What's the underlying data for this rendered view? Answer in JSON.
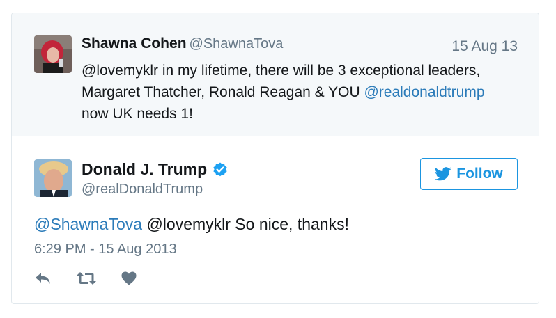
{
  "quoted_tweet": {
    "author_name": "Shawna Cohen",
    "author_handle": "@ShawnaTova",
    "date": "15 Aug 13",
    "text": {
      "mention": "@lovemyklr",
      "part1": " in my lifetime, there will be 3 exceptional leaders, Margaret Thatcher, Ronald Reagan & YOU ",
      "link_mention": "@realdonaldtrump",
      "part2": " now UK needs 1!"
    }
  },
  "tweet": {
    "author_name": "Donald J. Trump",
    "author_handle": "@realDonaldTrump",
    "verified_icon": "verified-badge-icon",
    "follow_label": "Follow",
    "text": {
      "reply_mention": "@ShawnaTova",
      "body": " @lovemyklr So nice, thanks!"
    },
    "timestamp": "6:29 PM - 15 Aug 2013",
    "actions": [
      "reply-icon",
      "retweet-icon",
      "like-icon"
    ]
  },
  "colors": {
    "link": "#2b7bb9",
    "follow": "#1b95e0",
    "muted": "#657786",
    "quoted_bg": "#f5f8fa"
  }
}
